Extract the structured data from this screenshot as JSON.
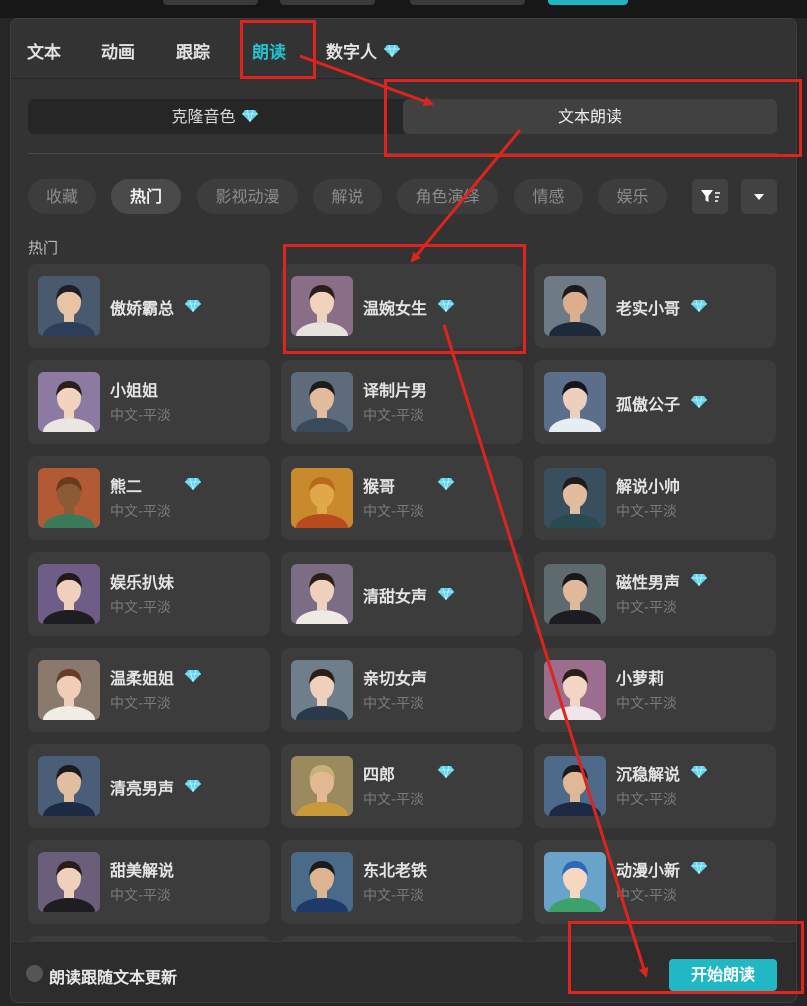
{
  "tabs": {
    "text": "文本",
    "animation": "动画",
    "tracking": "跟踪",
    "read_aloud": "朗读",
    "digital_human": "数字人"
  },
  "subtabs": {
    "clone_voice": "克隆音色",
    "text_read": "文本朗读"
  },
  "chips": [
    "收藏",
    "热门",
    "影视动漫",
    "解说",
    "角色演绎",
    "情感",
    "娱乐"
  ],
  "section_title": "热门",
  "voices": [
    {
      "name": "傲娇霸总",
      "sub": "",
      "premium": true
    },
    {
      "name": "温婉女生",
      "sub": "",
      "premium": true
    },
    {
      "name": "老实小哥",
      "sub": "",
      "premium": true
    },
    {
      "name": "小姐姐",
      "sub": "中文-平淡",
      "premium": false
    },
    {
      "name": "译制片男",
      "sub": "中文-平淡",
      "premium": false
    },
    {
      "name": "孤傲公子",
      "sub": "",
      "premium": true
    },
    {
      "name": "熊二",
      "sub": "中文-平淡",
      "premium": true
    },
    {
      "name": "猴哥",
      "sub": "中文-平淡",
      "premium": true
    },
    {
      "name": "解说小帅",
      "sub": "中文-平淡",
      "premium": false
    },
    {
      "name": "娱乐扒妹",
      "sub": "中文-平淡",
      "premium": false
    },
    {
      "name": "清甜女声",
      "sub": "",
      "premium": true
    },
    {
      "name": "磁性男声",
      "sub": "中文-平淡",
      "premium": true
    },
    {
      "name": "温柔姐姐",
      "sub": "中文-平淡",
      "premium": true
    },
    {
      "name": "亲切女声",
      "sub": "中文-平淡",
      "premium": false
    },
    {
      "name": "小萝莉",
      "sub": "中文-平淡",
      "premium": false
    },
    {
      "name": "清亮男声",
      "sub": "",
      "premium": true
    },
    {
      "name": "四郎",
      "sub": "中文-平淡",
      "premium": true
    },
    {
      "name": "沉稳解说",
      "sub": "中文-平淡",
      "premium": true
    },
    {
      "name": "甜美解说",
      "sub": "中文-平淡",
      "premium": false
    },
    {
      "name": "东北老铁",
      "sub": "中文-平淡",
      "premium": false
    },
    {
      "name": "动漫小新",
      "sub": "中文-平淡",
      "premium": true
    }
  ],
  "footer": {
    "follow_label": "朗读跟随文本更新",
    "start_button": "开始朗读"
  },
  "colors": {
    "accent": "#1fb8c4",
    "annotation": "#e0231c",
    "premium_gem": "#5fd3ec"
  }
}
